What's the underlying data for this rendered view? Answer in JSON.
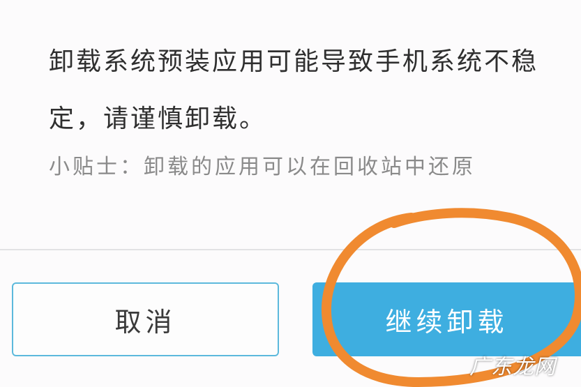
{
  "dialog": {
    "message": "卸载系统预装应用可能导致手机系统不稳定，请谨慎卸载。",
    "tip": "小贴士：卸载的应用可以在回收站中还原"
  },
  "buttons": {
    "cancel_label": "取消",
    "confirm_label": "继续卸载"
  },
  "watermark": "广东龙网",
  "colors": {
    "accent": "#3eaee0",
    "cancel_border": "#5cb9dc",
    "annotation_circle": "#f08a30"
  }
}
